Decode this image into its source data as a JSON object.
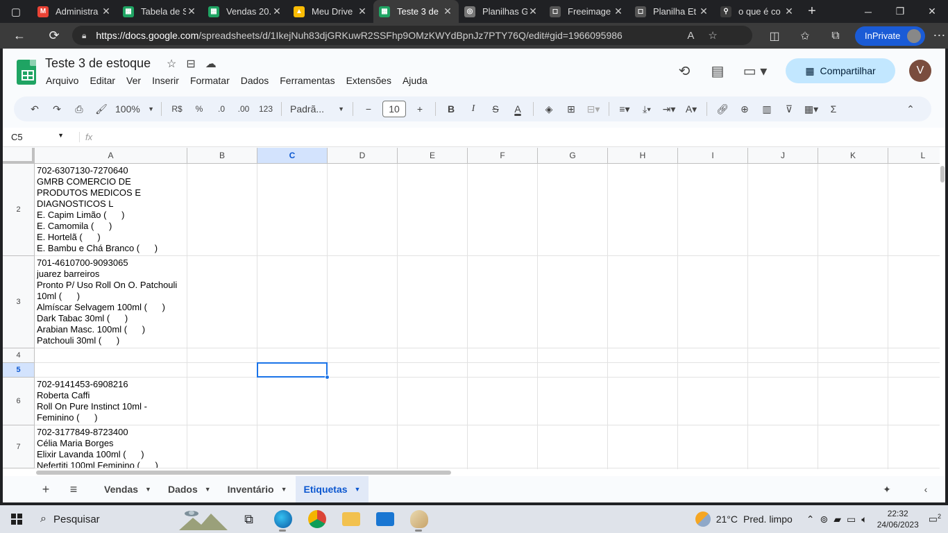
{
  "browser": {
    "tabs": [
      {
        "title": "Administra",
        "fav": "M",
        "color": "#ea4335"
      },
      {
        "title": "Tabela de S",
        "fav": "▦",
        "color": "#1fa463"
      },
      {
        "title": "Vendas 20.",
        "fav": "▦",
        "color": "#1fa463"
      },
      {
        "title": "Meu Drive",
        "fav": "▲",
        "color": "#fbbc04"
      },
      {
        "title": "Teste 3 de",
        "fav": "▦",
        "color": "#1fa463"
      },
      {
        "title": "Planilhas G",
        "fav": "◎",
        "color": "#777777"
      },
      {
        "title": "Freeimage",
        "fav": "◻",
        "color": "#555555"
      },
      {
        "title": "Planilha Et",
        "fav": "◻",
        "color": "#555555"
      },
      {
        "title": "o que é co",
        "fav": "⚲",
        "color": "#3b3b3b"
      }
    ],
    "active_tab_index": 4,
    "url_host": "https://docs.google.com",
    "url_path": "/spreadsheets/d/1IkejNuh83djGRKuwR2SSFhp9OMzKWYdBpnJz7PTY76Q/edit#gid=1966095986",
    "inprivate_label": "InPrivate"
  },
  "doc": {
    "title": "Teste 3 de estoque",
    "menu": [
      "Arquivo",
      "Editar",
      "Ver",
      "Inserir",
      "Formatar",
      "Dados",
      "Ferramentas",
      "Extensões",
      "Ajuda"
    ],
    "share_label": "Compartilhar",
    "user_initial": "V"
  },
  "toolbar": {
    "zoom": "100%",
    "currency": "R$",
    "percent": "%",
    "dec_decrease": ".0",
    "dec_increase": ".00",
    "number_format": "123",
    "font": "Padrã...",
    "font_size": "10"
  },
  "namebox": {
    "cell_ref": "C5",
    "fx": "fx"
  },
  "grid": {
    "columns": [
      "A",
      "B",
      "C",
      "D",
      "E",
      "F",
      "G",
      "H",
      "I",
      "J",
      "K",
      "L"
    ],
    "selected_column": "C",
    "rows": [
      {
        "num": "2",
        "text": "702-6307130-7270640\nGMRB COMERCIO DE\nPRODUTOS MEDICOS E\nDIAGNOSTICOS L\nE. Capim Limão (      )\nE. Camomila (      )\nE. Hortelã (      )\nE. Bambu e Chá Branco (      )"
      },
      {
        "num": "3",
        "text": "701-4610700-9093065\njuarez barreiros\nPronto P/ Uso Roll On O. Patchouli\n10ml (      )\nAlmíscar Selvagem 100ml (      )\nDark Tabac 30ml (      )\nArabian Masc. 100ml (      )\nPatchouli 30ml (      )"
      },
      {
        "num": "4",
        "text": ""
      },
      {
        "num": "5",
        "text": ""
      },
      {
        "num": "6",
        "text": "702-9141453-6908216\nRoberta Caffi\nRoll On Pure Instinct 10ml -\nFeminino (      )"
      },
      {
        "num": "7",
        "text": "702-3177849-8723400\nCélia Maria Borges\nElixir Lavanda 100ml (      )\nNefertiti 100ml Feminino (      )"
      }
    ],
    "selected_row": "5"
  },
  "sheet_tabs": {
    "tabs": [
      "Vendas",
      "Dados",
      "Inventário",
      "Etiquetas"
    ],
    "active": "Etiquetas"
  },
  "taskbar": {
    "search_placeholder": "Pesquisar",
    "weather_temp": "21°C",
    "weather_desc": "Pred. limpo",
    "time": "22:32",
    "date": "24/06/2023",
    "notifications": "2"
  }
}
